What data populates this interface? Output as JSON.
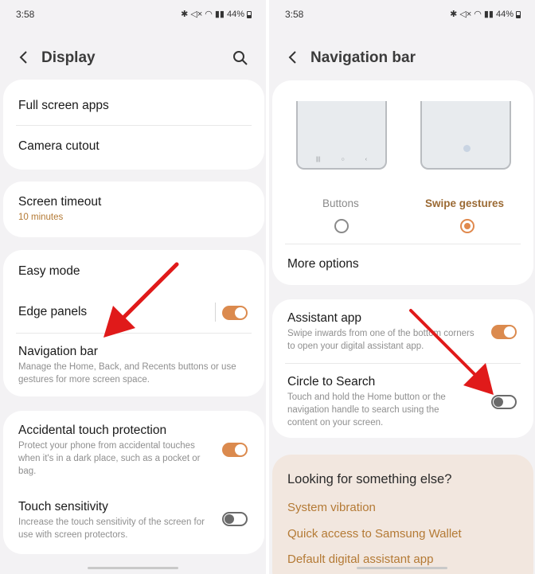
{
  "left": {
    "status": {
      "time": "3:58",
      "battery": "44%"
    },
    "header": {
      "title": "Display"
    },
    "card1": {
      "items": [
        "Full screen apps",
        "Camera cutout"
      ]
    },
    "card2": {
      "title": "Screen timeout",
      "value": "10 minutes"
    },
    "card3": {
      "easy_mode": "Easy mode",
      "edge_panels": "Edge panels",
      "navigation_bar": "Navigation bar",
      "navigation_bar_desc": "Manage the Home, Back, and Recents buttons or use gestures for more screen space."
    },
    "card4": {
      "accidental_title": "Accidental touch protection",
      "accidental_desc": "Protect your phone from accidental touches when it's in a dark place, such as a pocket or bag.",
      "sensitivity_title": "Touch sensitivity",
      "sensitivity_desc": "Increase the touch sensitivity of the screen for use with screen protectors."
    },
    "toggles": {
      "edge_panels": true,
      "accidental_touch": true,
      "touch_sensitivity": false
    }
  },
  "right": {
    "status": {
      "time": "3:58",
      "battery": "44%"
    },
    "header": {
      "title": "Navigation bar"
    },
    "nav_types": {
      "buttons_label": "Buttons",
      "gestures_label": "Swipe gestures",
      "selected": "Swipe gestures"
    },
    "more_options": "More options",
    "assistant": {
      "title": "Assistant app",
      "desc": "Swipe inwards from one of the bottom corners to open your digital assistant app."
    },
    "circle": {
      "title": "Circle to Search",
      "desc": "Touch and hold the Home button or the navigation handle to search using the content on your screen."
    },
    "toggles": {
      "assistant_app": true,
      "circle_to_search": false
    },
    "looking": {
      "title": "Looking for something else?",
      "links": [
        "System vibration",
        "Quick access to Samsung Wallet",
        "Default digital assistant app"
      ]
    }
  },
  "colors": {
    "accent": "#db8a4e",
    "arrow": "#e01a1a",
    "link": "#b47a35",
    "background": "#f3f2f4"
  }
}
